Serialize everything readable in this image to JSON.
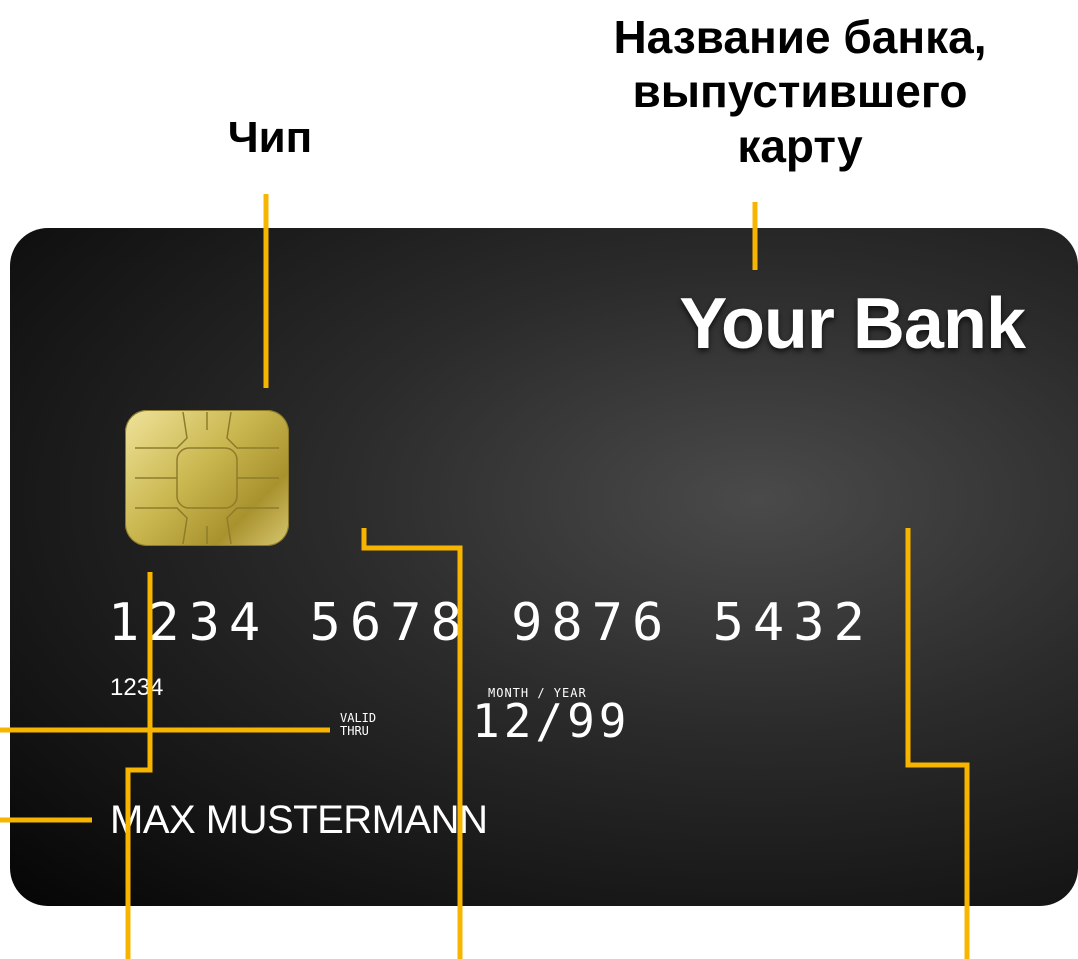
{
  "labels": {
    "chip": "Чип",
    "bank_name_line1": "Название банка,",
    "bank_name_line2": "выпустившего",
    "bank_name_line3": "карту"
  },
  "card": {
    "bank_name": "Your Bank",
    "number": "1234 5678 9876 5432",
    "small_number": "1234",
    "month_year_label": "MONTH / YEAR",
    "valid_label": "VALID",
    "thru_label": "THRU",
    "expiry": "12/99",
    "holder": "MAX MUSTERMANN"
  },
  "colors": {
    "leader_line": "#F7B500",
    "card_background": "#1c1c1c",
    "chip_gold": "#C9B64E"
  }
}
